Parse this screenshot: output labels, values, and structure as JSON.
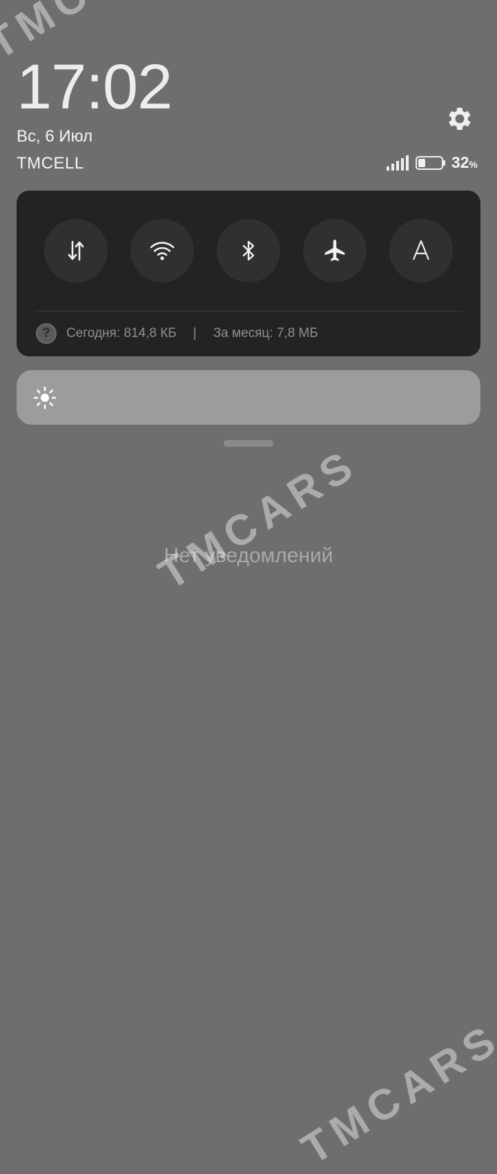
{
  "status": {
    "time": "17:02",
    "date": "Вс, 6 Июл",
    "carrier": "TMCELL",
    "battery_percent": "32",
    "battery_unit": "%",
    "battery_level": 0.32
  },
  "quick_settings": {
    "toggles": [
      {
        "name": "mobile-data",
        "icon": "data-arrows-icon"
      },
      {
        "name": "wifi",
        "icon": "wifi-icon"
      },
      {
        "name": "bluetooth",
        "icon": "bluetooth-icon"
      },
      {
        "name": "airplane-mode",
        "icon": "airplane-icon"
      },
      {
        "name": "auto-brightness",
        "icon": "letter-a-icon"
      }
    ],
    "usage_help": "?",
    "usage_today": "Сегодня: 814,8 КБ",
    "usage_separator": "|",
    "usage_month": "За месяц: 7,8 МБ"
  },
  "notifications": {
    "empty_text": "Нет уведомлений"
  },
  "watermark": "TMCARS",
  "colors": {
    "background": "#6e6e6e",
    "panel": "#232325",
    "toggle": "#303032",
    "brightness_bar": "#9c9c9c"
  }
}
